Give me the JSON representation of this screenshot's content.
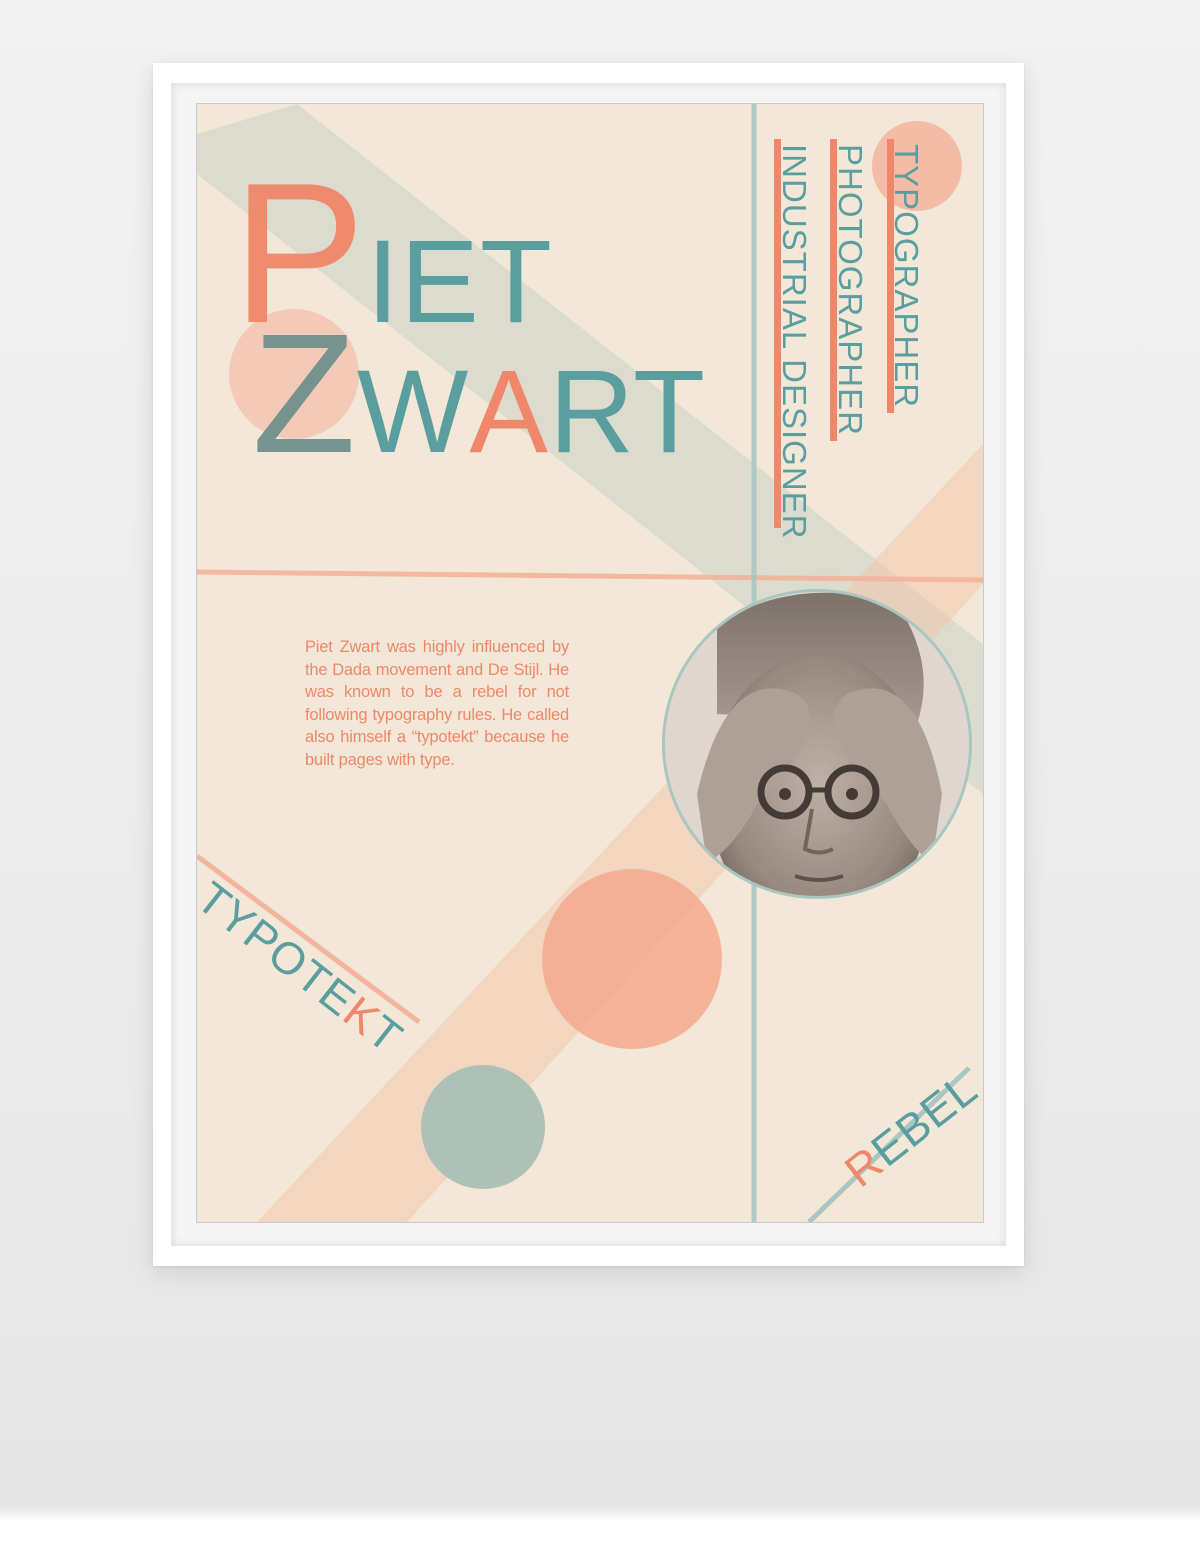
{
  "poster": {
    "title_line1_cap": "P",
    "title_line1_rest": "IET",
    "title_line2_cap": "Z",
    "title_line2_pre": "W",
    "title_line2_accent": "A",
    "title_line2_post": "RT",
    "roles": [
      "TYPOGRAPHER",
      "PHOTOGRAPHER",
      "INDUSTRIAL DESIGNER"
    ],
    "bio": "Piet Zwart was highly influenced by the Dada movement and De Stijl. He was known to be a rebel for not following typography rules. He called also himself a “typotekt” because he built pages with type.",
    "typotekt_pre": "TYPOTE",
    "typotekt_accent": "K",
    "typotekt_post": "T",
    "rebel_cap": "R",
    "rebel_rest": "EBEL"
  },
  "colors": {
    "coral": "#f0876a",
    "teal": "#5a9ea0",
    "cream": "#f3e7d7",
    "grey_teal_circle": "#a9bfb5",
    "peach_band": "#f2c9b1"
  },
  "portrait": {
    "subject": "black-and-white photo of a man with round glasses holding his head"
  }
}
